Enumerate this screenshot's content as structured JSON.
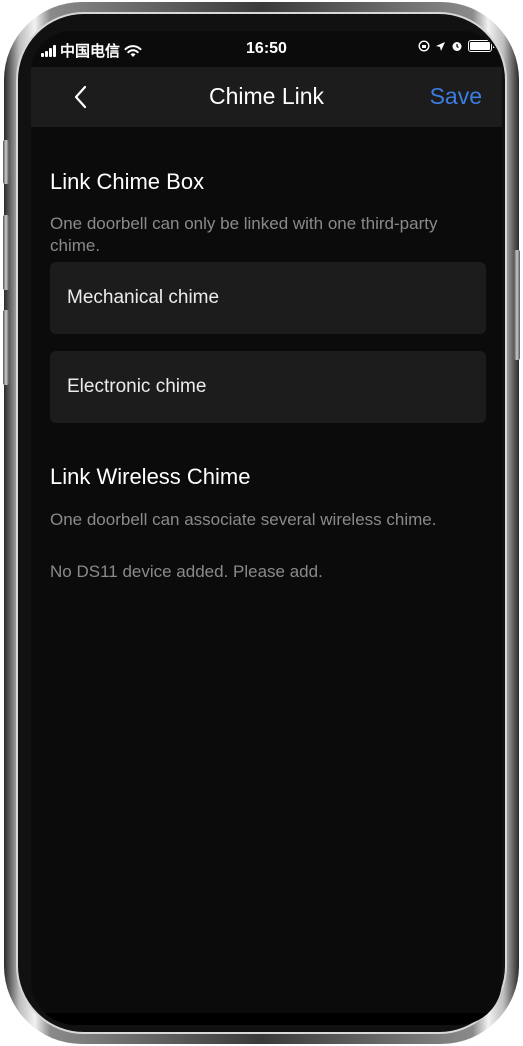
{
  "status_bar": {
    "carrier": "中国电信",
    "time": "16:50",
    "icons": [
      "signal-icon",
      "wifi-icon",
      "lock-rotation-icon",
      "location-icon",
      "alarm-icon",
      "battery-icon"
    ]
  },
  "nav": {
    "title": "Chime Link",
    "save_label": "Save",
    "back_icon": "chevron-left-icon",
    "accent_color": "#3b7de0"
  },
  "chime_box": {
    "title": "Link Chime Box",
    "description": "One doorbell can only be linked with one third-party chime.",
    "options": [
      {
        "label": "Mechanical chime"
      },
      {
        "label": "Electronic chime"
      }
    ]
  },
  "wireless_chime": {
    "title": "Link Wireless Chime",
    "description": "One doorbell can associate several wireless chime.",
    "empty_message": "No DS11 device added. Please add."
  }
}
